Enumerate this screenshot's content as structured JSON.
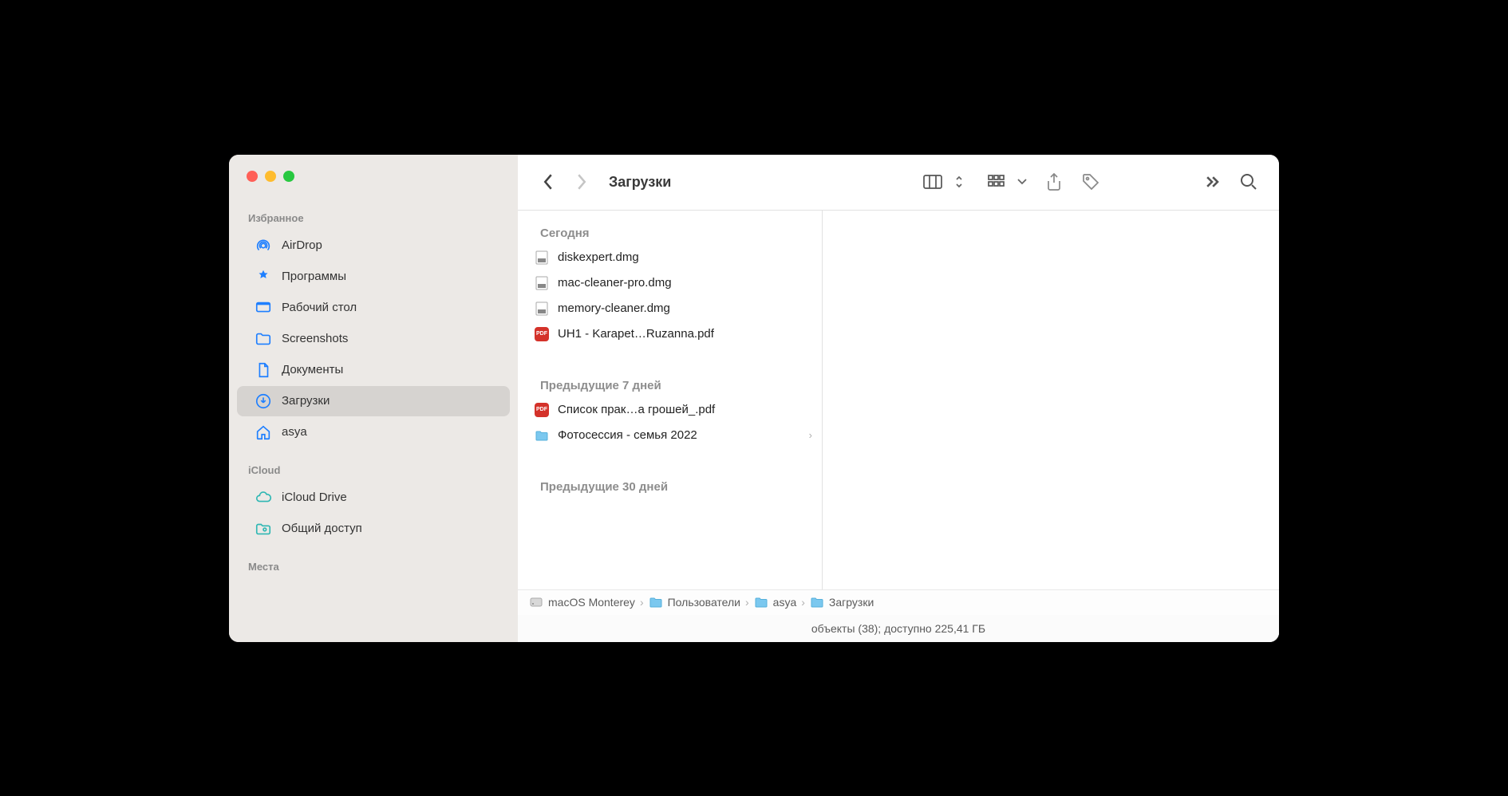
{
  "window_title": "Загрузки",
  "sidebar": {
    "sections": [
      {
        "label": "Избранное",
        "items": [
          {
            "id": "airdrop",
            "label": "AirDrop",
            "icon": "airdrop-icon",
            "color": "blue"
          },
          {
            "id": "applications",
            "label": "Программы",
            "icon": "apps-icon",
            "color": "blue"
          },
          {
            "id": "desktop",
            "label": "Рабочий стол",
            "icon": "desktop-icon",
            "color": "blue"
          },
          {
            "id": "screenshots",
            "label": "Screenshots",
            "icon": "folder-icon",
            "color": "blue"
          },
          {
            "id": "documents",
            "label": "Документы",
            "icon": "document-icon",
            "color": "blue"
          },
          {
            "id": "downloads",
            "label": "Загрузки",
            "icon": "download-icon",
            "color": "blue",
            "selected": true
          },
          {
            "id": "home",
            "label": "asya",
            "icon": "home-icon",
            "color": "blue"
          }
        ]
      },
      {
        "label": "iCloud",
        "items": [
          {
            "id": "icloud",
            "label": "iCloud Drive",
            "icon": "cloud-icon",
            "color": "teal"
          },
          {
            "id": "shared",
            "label": "Общий доступ",
            "icon": "shared-icon",
            "color": "teal"
          }
        ]
      },
      {
        "label": "Места",
        "items": []
      }
    ]
  },
  "content": {
    "groups": [
      {
        "header": "Сегодня",
        "rows": [
          {
            "type": "dmg",
            "name": "diskexpert.dmg"
          },
          {
            "type": "dmg",
            "name": "mac-cleaner-pro.dmg"
          },
          {
            "type": "dmg",
            "name": "memory-cleaner.dmg"
          },
          {
            "type": "pdf",
            "name": "UH1 - Karapet…Ruzanna.pdf"
          }
        ]
      },
      {
        "header": "Предыдущие 7 дней",
        "rows": [
          {
            "type": "pdf",
            "name": "Список прак…а грошей_.pdf"
          },
          {
            "type": "folder",
            "name": "Фотосессия - семья 2022",
            "has_chevron": true
          }
        ]
      },
      {
        "header": "Предыдущие 30 дней",
        "rows": []
      }
    ]
  },
  "pathbar": [
    {
      "icon": "hdd",
      "label": "macOS Monterey"
    },
    {
      "icon": "bfolder",
      "label": "Пользователи"
    },
    {
      "icon": "bfolder",
      "label": "asya"
    },
    {
      "icon": "bfolder",
      "label": "Загрузки"
    }
  ],
  "statusbar": "объекты (38); доступно 225,41 ГБ"
}
